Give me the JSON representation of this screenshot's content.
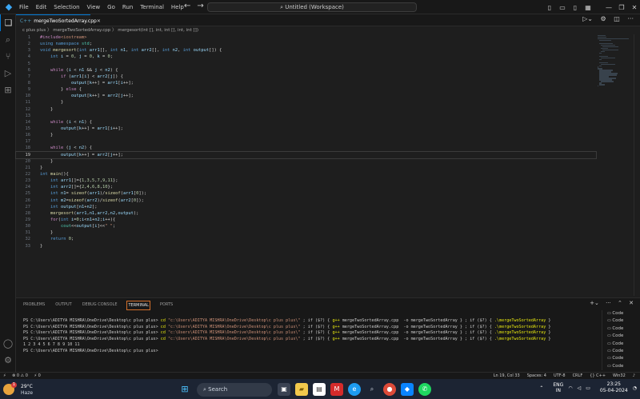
{
  "menu": [
    "File",
    "Edit",
    "Selection",
    "View",
    "Go",
    "Run",
    "Terminal",
    "Help"
  ],
  "command_center": "Untitled (Workspace)",
  "tab": {
    "label": "mergeTwoSortedArray.cpp",
    "lang": "C++"
  },
  "breadcrumb": "c plus plus  〉  mergeTwoSortedArray.cpp  〉  mergesort(int [], int, int [], int, int [])",
  "code_lines": [
    "#include<iostream>",
    "using namespace std;",
    "void mergesort(int arr1[], int n1, int arr2[], int n2, int output[]) {",
    "    int i = 0, j = 0, k = 0;",
    "",
    "    while (i < n1 && j < n2) {",
    "        if (arr1[i] < arr2[j]) {",
    "            output[k++] = arr1[i++];",
    "        } else {",
    "            output[k++] = arr2[j++];",
    "        }",
    "    }",
    "",
    "    while (i < n1) {",
    "        output[k++] = arr1[i++];",
    "    }",
    "",
    "    while (j < n2) {",
    "        output[k++] = arr2[j++];",
    "    }",
    "}",
    "int main(){",
    "    int arr1[]={1,3,5,7,9,11};",
    "    int arr2[]={2,4,6,8,10};",
    "    int n1= sizeof(arr1)/sizeof(arr1[0]);",
    "    int m2=sizeof(arr2)/sizeof(arr2[0]);",
    "    int output[n1+n2];",
    "    mergesort(arr1,n1,arr2,n2,output);",
    "    for(int i=0;i<n1+n2;i++){",
    "        cout<<output[i]<<\" \";",
    "    }",
    "    return 0;",
    "}"
  ],
  "active_line": 19,
  "panel_tabs": [
    "PROBLEMS",
    "OUTPUT",
    "DEBUG CONSOLE",
    "TERMINAL",
    "PORTS"
  ],
  "active_panel_tab": "TERMINAL",
  "terminal": {
    "prompt": "PS C:\\Users\\ADITYA MISHRA\\OneDrive\\Desktop\\c plus plus>",
    "cd": "cd",
    "path": "\"c:\\Users\\ADITYA MISHRA\\OneDrive\\Desktop\\c plus plus\\\"",
    "mid1": " ; if ($?) {",
    "gpp": " g++",
    "mid2": " mergeTwoSortedArray.cpp  -o mergeTwoSortedArray } ; if ($?) {",
    "run": " .\\mergeTwoSortedArray",
    "end": " }",
    "output": "1 2 3 4 5 6 7 8 9 10 11",
    "runs": 4
  },
  "terminal_list": [
    "Code",
    "Code",
    "Code",
    "Code",
    "Code",
    "Code",
    "Code",
    "Code"
  ],
  "status_left": [
    "⊗ 0 ⚠ 0",
    "⚡ 0"
  ],
  "status_right": [
    "Ln 19, Col 33",
    "Spaces: 4",
    "UTF-8",
    "CRLF",
    "{} C++",
    "Win32"
  ],
  "weather": {
    "temp": "29°C",
    "desc": "Haze",
    "badge": "1"
  },
  "search_label": "Search",
  "tray": {
    "lang1": "ENG",
    "lang2": "IN",
    "time": "23:25",
    "date": "05-04-2024"
  },
  "colors": {
    "accent": "#0078d4",
    "keyword": "#569cd6",
    "control": "#c586c0",
    "type": "#4ec9b0",
    "func": "#dcdcaa",
    "var": "#9cdcfe",
    "number": "#b5cea8",
    "string": "#ce9178",
    "include": "#c586c0"
  }
}
